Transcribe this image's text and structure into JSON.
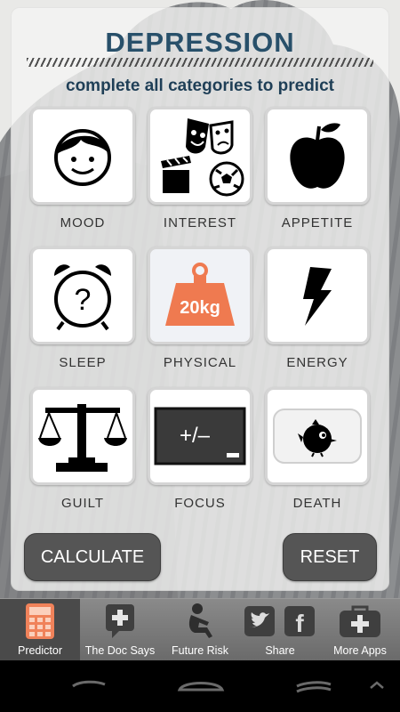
{
  "header": {
    "title": "DEPRESSION",
    "subtitle": "complete all categories to predict"
  },
  "categories": [
    {
      "label": "MOOD",
      "icon": "smiley-face-icon"
    },
    {
      "label": "INTEREST",
      "icon": "theater-masks-film-soccer-icon"
    },
    {
      "label": "APPETITE",
      "icon": "apple-icon"
    },
    {
      "label": "SLEEP",
      "icon": "alarm-clock-question-icon"
    },
    {
      "label": "PHYSICAL",
      "icon": "weight-20kg-icon",
      "weight_text": "20kg"
    },
    {
      "label": "ENERGY",
      "icon": "lightning-bolt-icon"
    },
    {
      "label": "GUILT",
      "icon": "scales-icon"
    },
    {
      "label": "FOCUS",
      "icon": "chalkboard-plus-minus-icon",
      "board_text": "+/–"
    },
    {
      "label": "DEATH",
      "icon": "black-bird-icon"
    }
  ],
  "actions": {
    "calculate_label": "CALCULATE",
    "reset_label": "RESET"
  },
  "tabs": [
    {
      "label": "Predictor",
      "icon": "calculator-icon",
      "active": true
    },
    {
      "label": "The Doc Says",
      "icon": "speech-bubble-plus-icon",
      "active": false
    },
    {
      "label": "Future Risk",
      "icon": "sitting-person-icon",
      "active": false
    },
    {
      "label": "Share",
      "icon": "twitter-facebook-icon",
      "active": false
    },
    {
      "label": "More Apps",
      "icon": "toolbox-plus-icon",
      "active": false
    }
  ],
  "colors": {
    "title": "#28506a",
    "subtitle": "#1f3f57",
    "button": "#555555",
    "active_tab_icon": "#f0825a",
    "weight_fill": "#ef7a50"
  }
}
